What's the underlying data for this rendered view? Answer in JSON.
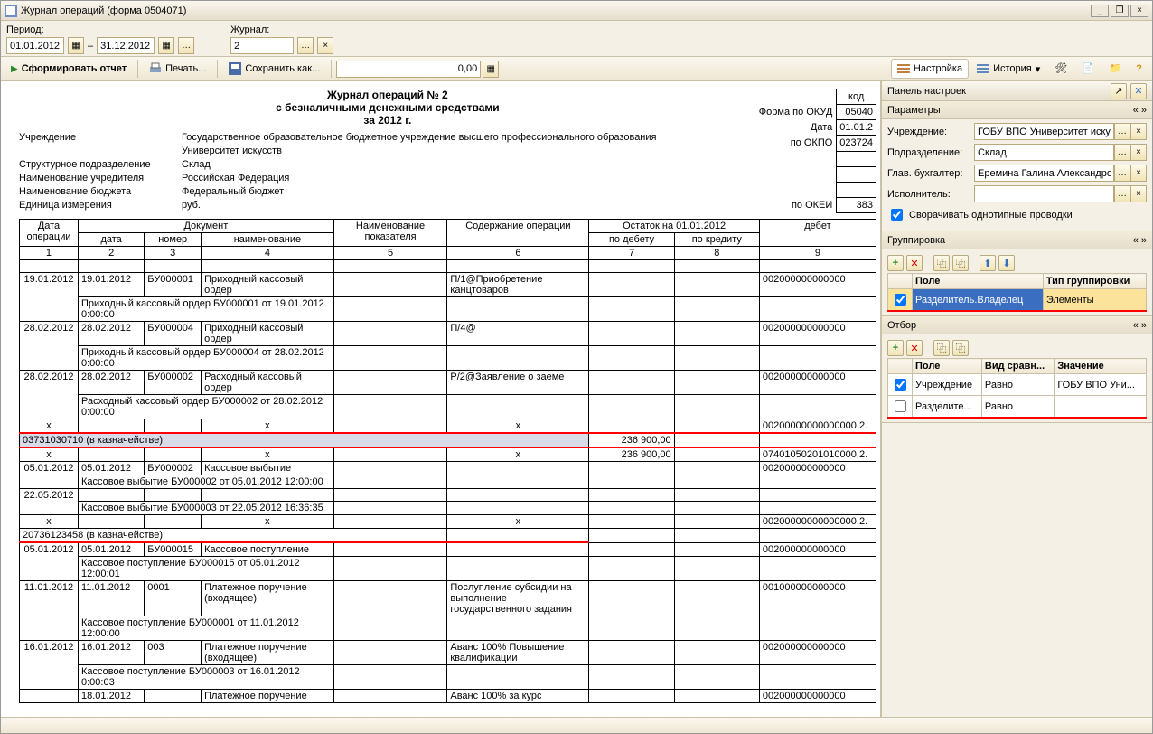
{
  "window": {
    "title": "Журнал операций (форма 0504071)"
  },
  "form": {
    "period_label": "Период:",
    "journal_label": "Журнал:",
    "date_from": "01.01.2012",
    "date_to": "31.12.2012",
    "journal": "2"
  },
  "toolbar": {
    "generate": "Сформировать отчет",
    "print": "Печать...",
    "save": "Сохранить как...",
    "number": "0,00",
    "settings": "Настройка",
    "history": "История"
  },
  "report": {
    "title1": "Журнал операций № 2",
    "title2": "с безналичными денежными средствами",
    "period": "за 2012 г.",
    "meta_labels": {
      "inst": "Учреждение",
      "struct": "Структурное подразделение",
      "founder": "Наименование учредителя",
      "budget": "Наименование бюджета",
      "unit": "Единица измерения"
    },
    "meta_vals": {
      "inst1": "Государственное образовательное бюджетное учреждение высшего профессионального образования",
      "inst2": "Университет искусств",
      "struct": "Склад",
      "founder": "Российская Федерация",
      "budget": "Федеральный бюджет",
      "unit": "руб."
    },
    "codes": {
      "form_lbl": "Форма по ОКУД",
      "date_lbl": "Дата",
      "okpo_lbl": "по ОКПО",
      "okei_lbl": "по ОКЕИ",
      "code_hdr": "код",
      "form": "05040",
      "date": "01.01.2",
      "okpo": "023724",
      "okei": "383"
    },
    "grid_headers": {
      "date_op": "Дата операции",
      "doc": "Документ",
      "date": "дата",
      "num": "номер",
      "name": "наименование",
      "metric": "Наименование показателя",
      "content": "Содержание операции",
      "balance": "Остаток на 01.01.2012",
      "debit": "по дебету",
      "credit": "по кредиту",
      "debit2": "дебет",
      "c1": "1",
      "c2": "2",
      "c3": "3",
      "c4": "4",
      "c5": "5",
      "c6": "6",
      "c7": "7",
      "c8": "8",
      "c9": "9"
    },
    "rows": [
      {
        "type": "data",
        "date_op": "19.01.2012",
        "date": "19.01.2012",
        "num": "БУ000001",
        "name": "Приходный кассовый ордер",
        "content": "П/1@Приобретение канцтоваров",
        "acct": "002000000000000"
      },
      {
        "type": "sub",
        "text": "Приходный кассовый ордер БУ000001 от 19.01.2012 0:00:00"
      },
      {
        "type": "data",
        "date_op": "28.02.2012",
        "date": "28.02.2012",
        "num": "БУ000004",
        "name": "Приходный кассовый ордер",
        "content": "П/4@",
        "acct": "002000000000000"
      },
      {
        "type": "sub",
        "text": "Приходный кассовый ордер БУ000004 от 28.02.2012 0:00:00"
      },
      {
        "type": "data",
        "date_op": "28.02.2012",
        "date": "28.02.2012",
        "num": "БУ000002",
        "name": "Расходный кассовый ордер",
        "content": "Р/2@Заявление о заеме",
        "acct": "002000000000000"
      },
      {
        "type": "sub",
        "text": "Расходный кассовый ордер БУ000002 от 28.02.2012 0:00:00"
      },
      {
        "type": "x",
        "acct": "00200000000000000.2."
      },
      {
        "type": "hl",
        "text": "03731030710 (в казначействе)",
        "debit": "236 900,00"
      },
      {
        "type": "x",
        "debit": "236 900,00",
        "acct": "07401050201010000.2."
      },
      {
        "type": "data",
        "date_op": "05.01.2012",
        "date": "05.01.2012",
        "num": "БУ000002",
        "name": "Кассовое выбытие",
        "acct": "002000000000000"
      },
      {
        "type": "sub",
        "text": "Кассовое выбытие БУ000002 от 05.01.2012 12:00:00"
      },
      {
        "type": "data",
        "date_op": "22.05.2012"
      },
      {
        "type": "sub",
        "text": "Кассовое выбытие БУ000003 от 22.05.2012 16:36:35"
      },
      {
        "type": "x",
        "acct": "00200000000000000.2."
      },
      {
        "type": "hl2",
        "text": "20736123458 (в казначействе)"
      },
      {
        "type": "data",
        "date_op": "05.01.2012",
        "date": "05.01.2012",
        "num": "БУ000015",
        "name": "Кассовое поступление",
        "acct": "002000000000000"
      },
      {
        "type": "sub",
        "text": "Кассовое поступление БУ000015 от 05.01.2012 12:00:01"
      },
      {
        "type": "data",
        "date_op": "11.01.2012",
        "date": "11.01.2012",
        "num": "0001",
        "name": "Платежное поручение (входящее)",
        "content": "Послупление субсидии на выполнение государственного задания",
        "acct": "001000000000000"
      },
      {
        "type": "sub",
        "text": "Кассовое поступление БУ000001 от 11.01.2012 12:00:00"
      },
      {
        "type": "data",
        "date_op": "16.01.2012",
        "date": "16.01.2012",
        "num": "003",
        "name": "Платежное поручение (входящее)",
        "content": "Аванс 100% Повышение квалификации",
        "acct": "002000000000000"
      },
      {
        "type": "sub",
        "text": "Кассовое поступление БУ000003 от 16.01.2012 0:00:03"
      },
      {
        "type": "data",
        "date_op": "",
        "date": "18.01.2012",
        "num": "",
        "name": "Платежное поручение",
        "content": "Аванс 100% за курс",
        "acct": "002000000000000"
      }
    ]
  },
  "panel": {
    "title": "Панель настроек",
    "params": {
      "title": "Параметры",
      "inst_lbl": "Учреждение:",
      "inst": "ГОБУ ВПО Университет искус",
      "dept_lbl": "Подразделение:",
      "dept": "Склад",
      "acc_lbl": "Глав. бухгалтер:",
      "acc": "Еремина Галина Александровн",
      "perf_lbl": "Исполнитель:",
      "perf": "",
      "fold": "Сворачивать однотипные проводки"
    },
    "group": {
      "title": "Группировка",
      "col1": "Поле",
      "col2": "Тип группировки",
      "row_field": "Разделитель.Владелец",
      "row_type": "Элементы"
    },
    "filter": {
      "title": "Отбор",
      "col1": "Поле",
      "col2": "Вид сравн...",
      "col3": "Значение",
      "r1_field": "Учреждение",
      "r1_cmp": "Равно",
      "r1_val": "ГОБУ ВПО Уни...",
      "r2_field": "Разделите...",
      "r2_cmp": "Равно"
    }
  }
}
